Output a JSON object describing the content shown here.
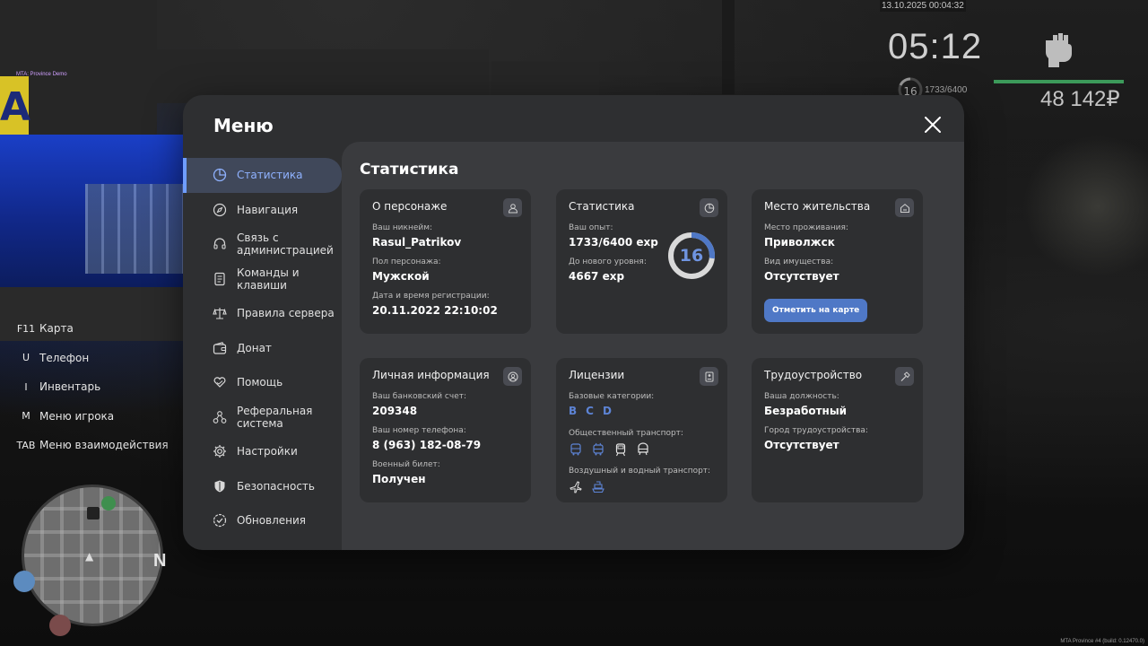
{
  "watermark_top": "MTA: Province Demo",
  "watermark_bottom": "MTA Province #4 (build: 0.12470.0)",
  "hud": {
    "datetime": "13.10.2025 00:04:32",
    "clock": "05:12",
    "level": "16",
    "exp": "1733/6400",
    "money": "48 142₽",
    "health_color": "#3c9a5a"
  },
  "hints": [
    {
      "key": "F11",
      "label": "Карта"
    },
    {
      "key": "U",
      "label": "Телефон"
    },
    {
      "key": "I",
      "label": "Инвентарь"
    },
    {
      "key": "M",
      "label": "Меню игрока"
    },
    {
      "key": "TAB",
      "label": "Меню взаимодействия"
    }
  ],
  "minimap": {
    "north": "N"
  },
  "menu": {
    "title": "Меню",
    "close_icon": "close-icon",
    "sidebar": [
      {
        "label": "Статистика",
        "icon": "pie-chart-icon",
        "active": true
      },
      {
        "label": "Навигация",
        "icon": "compass-icon"
      },
      {
        "label": "Связь с\nадминистрацией",
        "icon": "headset-icon"
      },
      {
        "label": "Команды и\nклавиши",
        "icon": "document-icon"
      },
      {
        "label": "Правила сервера",
        "icon": "scales-icon"
      },
      {
        "label": "Донат",
        "icon": "wallet-icon"
      },
      {
        "label": "Помощь",
        "icon": "heart-hands-icon"
      },
      {
        "label": "Реферальная\nсистема",
        "icon": "network-icon"
      },
      {
        "label": "Настройки",
        "icon": "gear-icon"
      },
      {
        "label": "Безопасность",
        "icon": "shield-icon"
      },
      {
        "label": "Обновления",
        "icon": "check-badge-icon"
      }
    ],
    "content_title": "Статистика",
    "cards": {
      "character": {
        "title": "О персонаже",
        "icon": "user-icon",
        "nickname_label": "Ваш никнейм:",
        "nickname": "Rasul_Patrikov",
        "gender_label": "Пол персонажа:",
        "gender": "Мужской",
        "reg_label": "Дата и время регистрации:",
        "reg": "20.11.2022 22:10:02"
      },
      "stats": {
        "title": "Статистика",
        "icon": "pie-chart-icon",
        "exp_label": "Ваш опыт:",
        "exp": "1733/6400 exp",
        "next_label": "До нового уровня:",
        "next": "4667 exp",
        "level": "16",
        "progress": 0.27,
        "ring_color": "#4f78c6"
      },
      "residence": {
        "title": "Место жительства",
        "icon": "home-icon",
        "place_label": "Место проживания:",
        "place": "Приволжск",
        "property_label": "Вид имущества:",
        "property": "Отсутствует",
        "button": "Отметить на карте"
      },
      "personal": {
        "title": "Личная информация",
        "icon": "user-circle-icon",
        "bank_label": "Ваш банковский счет:",
        "bank": "209348",
        "phone_label": "Ваш номер телефона:",
        "phone": "8 (963) 182-08-79",
        "military_label": "Военный билет:",
        "military": "Получен"
      },
      "licenses": {
        "title": "Лицензии",
        "icon": "id-card-icon",
        "base_label": "Базовые категории:",
        "base": [
          "B",
          "C",
          "D"
        ],
        "public_label": "Общественный транспорт:",
        "air_water_label": "Воздушный и водный транспорт:"
      },
      "employment": {
        "title": "Трудоустройство",
        "icon": "hammer-icon",
        "position_label": "Ваша должность:",
        "position": "Безработный",
        "city_label": "Город трудоустройства:",
        "city": "Отсутствует"
      }
    }
  },
  "colors": {
    "accent": "#6f9dff",
    "button": "#4f78c6",
    "panel": "#2e2f31",
    "content": "#3a3b3e"
  }
}
